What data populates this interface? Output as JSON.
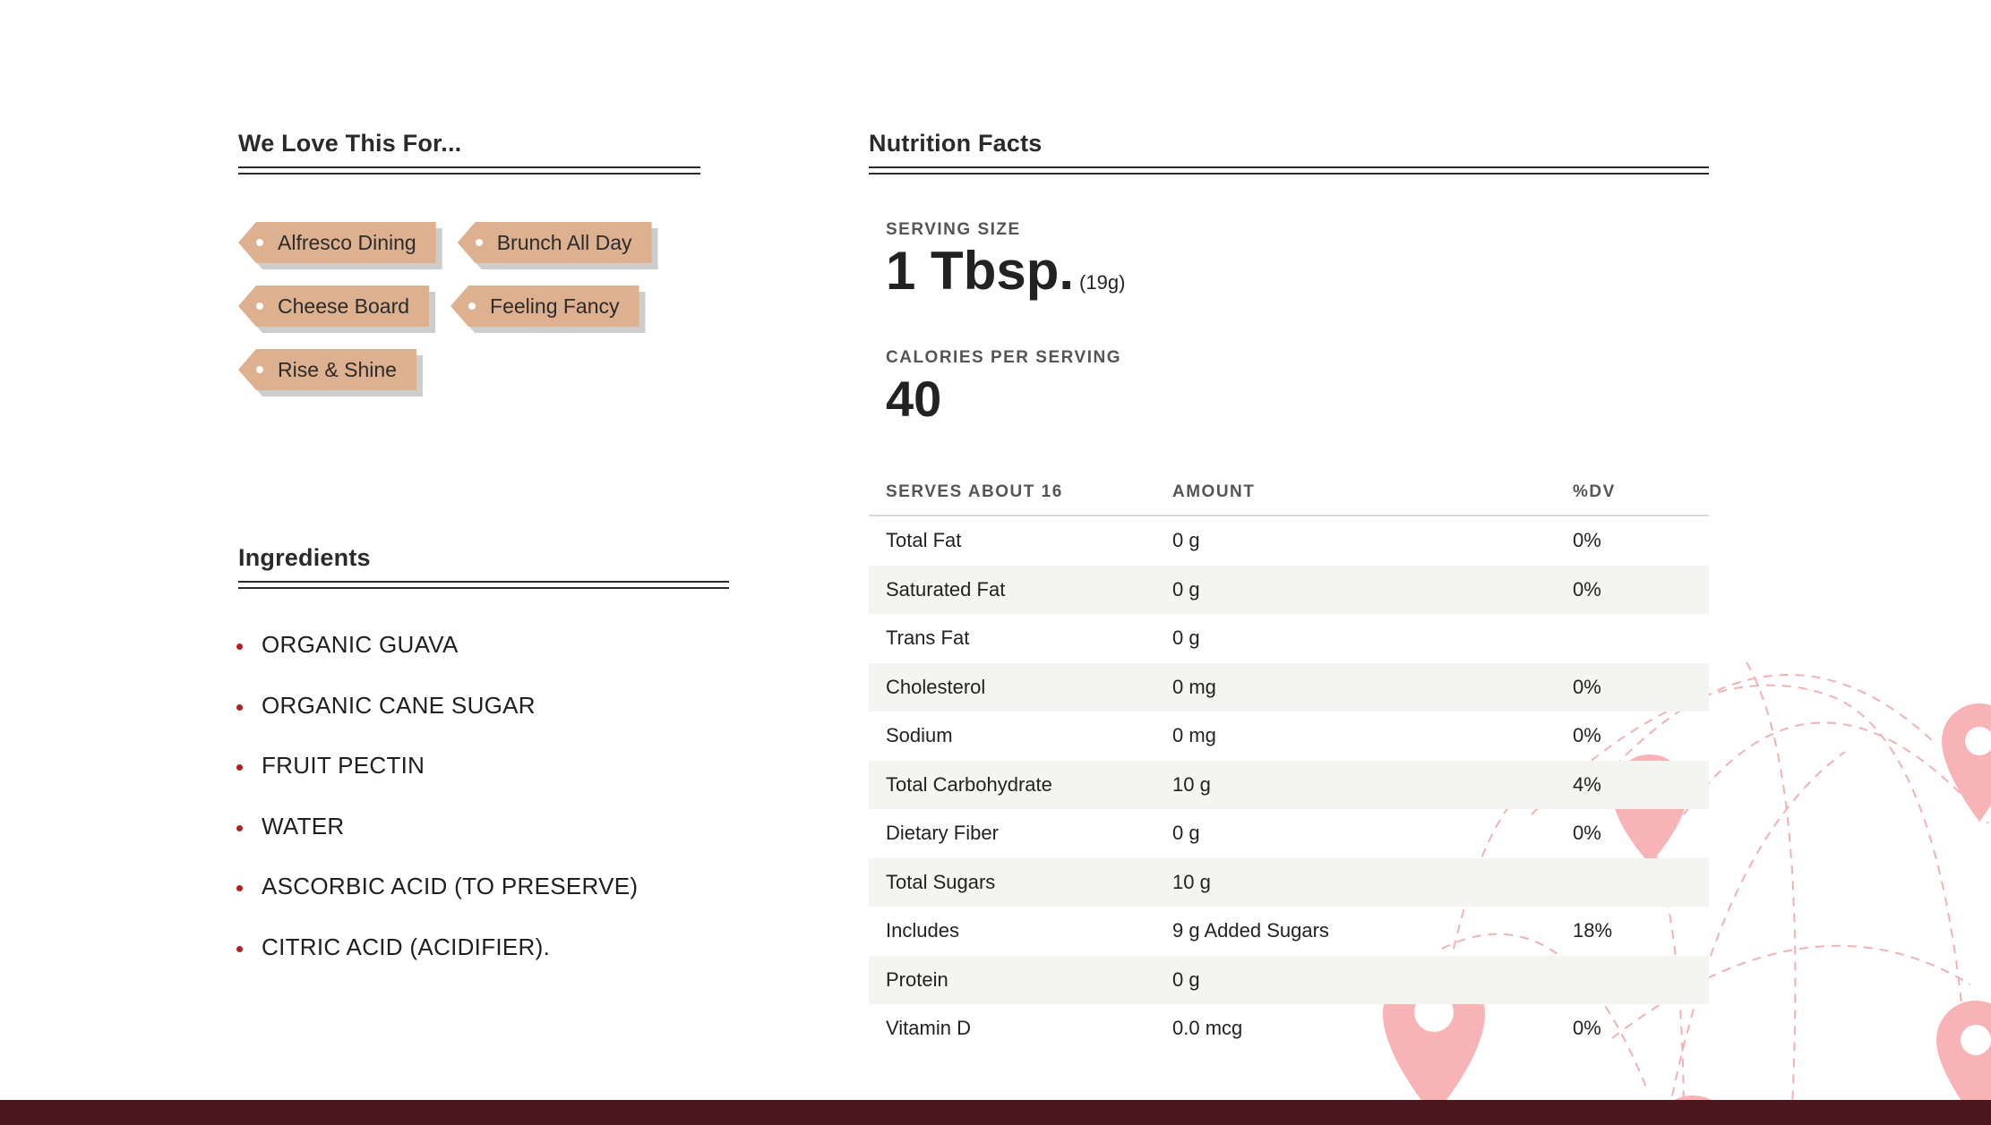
{
  "love": {
    "title": "We Love This For...",
    "tags": [
      "Alfresco Dining",
      "Brunch All Day",
      "Cheese Board",
      "Feeling Fancy",
      "Rise & Shine"
    ]
  },
  "ingredients": {
    "title": "Ingredients",
    "items": [
      "ORGANIC GUAVA",
      "ORGANIC CANE SUGAR",
      "FRUIT PECTIN",
      "WATER",
      "ASCORBIC ACID (TO PRESERVE)",
      "CITRIC ACID (ACIDIFIER)."
    ]
  },
  "nutrition": {
    "title": "Nutrition Facts",
    "serving_label": "SERVING SIZE",
    "serving_value": "1 Tbsp.",
    "serving_grams": "(19g)",
    "calories_label": "CALORIES PER SERVING",
    "calories_value": "40",
    "headers": [
      "SERVES ABOUT 16",
      "AMOUNT",
      "%DV"
    ],
    "rows": [
      {
        "name": "Total Fat",
        "amount": "0 g",
        "dv": "0%"
      },
      {
        "name": "Saturated Fat",
        "amount": "0 g",
        "dv": "0%"
      },
      {
        "name": "Trans Fat",
        "amount": "0 g",
        "dv": ""
      },
      {
        "name": "Cholesterol",
        "amount": "0 mg",
        "dv": "0%"
      },
      {
        "name": "Sodium",
        "amount": "0 mg",
        "dv": "0%"
      },
      {
        "name": "Total Carbohydrate",
        "amount": "10 g",
        "dv": "4%"
      },
      {
        "name": "Dietary Fiber",
        "amount": "0 g",
        "dv": "0%"
      },
      {
        "name": "Total Sugars",
        "amount": "10 g",
        "dv": ""
      },
      {
        "name": "Includes",
        "amount": "9 g Added Sugars",
        "dv": "18%"
      },
      {
        "name": "Protein",
        "amount": "0 g",
        "dv": ""
      },
      {
        "name": "Vitamin D",
        "amount": "0.0 mcg",
        "dv": "0%"
      }
    ]
  },
  "colors": {
    "tag": "#ddb190",
    "bullet": "#b32020",
    "footer": "#4d161c",
    "pin": "#f7b3b5"
  }
}
